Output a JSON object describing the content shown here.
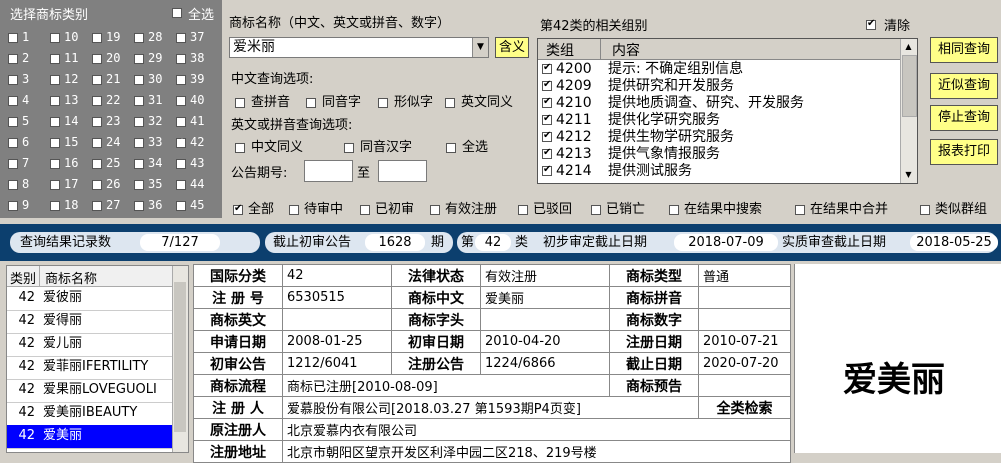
{
  "category_panel": {
    "title": "选择商标类别",
    "select_all_label": "全选",
    "select_all_checked": false,
    "categories": [
      {
        "n": "1",
        "c": false
      },
      {
        "n": "10",
        "c": false
      },
      {
        "n": "19",
        "c": false
      },
      {
        "n": "28",
        "c": false
      },
      {
        "n": "37",
        "c": false
      },
      {
        "n": "2",
        "c": false
      },
      {
        "n": "11",
        "c": false
      },
      {
        "n": "20",
        "c": false
      },
      {
        "n": "29",
        "c": false
      },
      {
        "n": "38",
        "c": false
      },
      {
        "n": "3",
        "c": false
      },
      {
        "n": "12",
        "c": false
      },
      {
        "n": "21",
        "c": false
      },
      {
        "n": "30",
        "c": false
      },
      {
        "n": "39",
        "c": false
      },
      {
        "n": "4",
        "c": false
      },
      {
        "n": "13",
        "c": false
      },
      {
        "n": "22",
        "c": false
      },
      {
        "n": "31",
        "c": false
      },
      {
        "n": "40",
        "c": false
      },
      {
        "n": "5",
        "c": false
      },
      {
        "n": "14",
        "c": false
      },
      {
        "n": "23",
        "c": false
      },
      {
        "n": "32",
        "c": false
      },
      {
        "n": "41",
        "c": false
      },
      {
        "n": "6",
        "c": false
      },
      {
        "n": "15",
        "c": false
      },
      {
        "n": "24",
        "c": false
      },
      {
        "n": "33",
        "c": false
      },
      {
        "n": "42",
        "c": true
      },
      {
        "n": "7",
        "c": false
      },
      {
        "n": "16",
        "c": false
      },
      {
        "n": "25",
        "c": false
      },
      {
        "n": "34",
        "c": false
      },
      {
        "n": "43",
        "c": false
      },
      {
        "n": "8",
        "c": false
      },
      {
        "n": "17",
        "c": false
      },
      {
        "n": "26",
        "c": false
      },
      {
        "n": "35",
        "c": false
      },
      {
        "n": "44",
        "c": false
      },
      {
        "n": "9",
        "c": false
      },
      {
        "n": "18",
        "c": false
      },
      {
        "n": "27",
        "c": false
      },
      {
        "n": "36",
        "c": false
      },
      {
        "n": "45",
        "c": false
      }
    ]
  },
  "search": {
    "name_label": "商标名称（中文、英文或拼音、数字）",
    "name_value": "爱米丽",
    "meaning_button": "含义",
    "chinese_options_label": "中文查询选项:",
    "chinese_options": [
      {
        "label": "查拼音",
        "checked": false
      },
      {
        "label": "同音字",
        "checked": false
      },
      {
        "label": "形似字",
        "checked": false
      },
      {
        "label": "英文同义",
        "checked": false
      }
    ],
    "english_options_label": "英文或拼音查询选项:",
    "english_options": [
      {
        "label": "中文同义",
        "checked": false
      },
      {
        "label": "同音汉字",
        "checked": false
      },
      {
        "label": "全选",
        "checked": false
      }
    ],
    "issue_label": "公告期号:",
    "issue_to": "至",
    "issue_from_value": "",
    "issue_to_value": ""
  },
  "groups": {
    "title": "第42类的相关组别",
    "clear_label": "清除",
    "clear_checked": true,
    "col_group": "类组",
    "col_content": "内容",
    "rows": [
      {
        "code": "4200",
        "text": "提示: 不确定组别信息",
        "checked": true
      },
      {
        "code": "4209",
        "text": "提供研究和开发服务",
        "checked": true
      },
      {
        "code": "4210",
        "text": "提供地质调查、研究、开发服务",
        "checked": true
      },
      {
        "code": "4211",
        "text": "提供化学研究服务",
        "checked": true
      },
      {
        "code": "4212",
        "text": "提供生物学研究服务",
        "checked": true
      },
      {
        "code": "4213",
        "text": "提供气象情报服务",
        "checked": true
      },
      {
        "code": "4214",
        "text": "提供测试服务",
        "checked": true
      }
    ]
  },
  "actions": {
    "same": "相同查询",
    "similar": "近似查询",
    "stop": "停止查询",
    "print": "报表打印"
  },
  "filters": [
    {
      "label": "全部",
      "checked": true
    },
    {
      "label": "待审中",
      "checked": false
    },
    {
      "label": "已初审",
      "checked": false
    },
    {
      "label": "有效注册",
      "checked": false
    },
    {
      "label": "已驳回",
      "checked": false
    },
    {
      "label": "已销亡",
      "checked": false
    },
    {
      "label": "在结果中搜索",
      "checked": false
    },
    {
      "label": "在结果中合并",
      "checked": false
    },
    {
      "label": "类似群组",
      "checked": false
    }
  ],
  "statusbar": {
    "record_label": "查询结果记录数",
    "record_value": "7/127",
    "cutoff_label": "截止初审公告",
    "cutoff_value": "1628",
    "cutoff_unit": "期",
    "class_prefix": "第",
    "class_value": "42",
    "class_suffix": "类",
    "prelim_label": "初步审定截止日期",
    "prelim_value": "2018-07-09",
    "substantive_label": "实质审查截止日期",
    "substantive_value": "2018-05-25"
  },
  "results": {
    "col_class": "类别",
    "col_name": "商标名称",
    "rows": [
      {
        "cls": "42",
        "name": "爱彼丽"
      },
      {
        "cls": "42",
        "name": "爱得丽"
      },
      {
        "cls": "42",
        "name": "爱儿丽"
      },
      {
        "cls": "42",
        "name": "爱菲丽IFERTILITY"
      },
      {
        "cls": "42",
        "name": "爱果丽LOVEGUOLI"
      },
      {
        "cls": "42",
        "name": "爱美丽IBEAUTY"
      },
      {
        "cls": "42",
        "name": "爱美丽"
      }
    ],
    "selected_index": 6
  },
  "detail": {
    "intl_class_k": "国际分类",
    "intl_class_v": "42",
    "legal_k": "法律状态",
    "legal_v": "有效注册",
    "type_k": "商标类型",
    "type_v": "普通",
    "regno_k": "注 册 号",
    "regno_v": "6530515",
    "cn_k": "商标中文",
    "cn_v": "爱美丽",
    "py_k": "商标拼音",
    "py_v": "",
    "en_k": "商标英文",
    "en_v": "",
    "head_k": "商标字头",
    "head_v": "",
    "num_k": "商标数字",
    "num_v": "",
    "apply_k": "申请日期",
    "apply_v": "2008-01-25",
    "prelim_k": "初审日期",
    "prelim_v": "2010-04-20",
    "regdate_k": "注册日期",
    "regdate_v": "2010-07-21",
    "prelimpub_k": "初审公告",
    "prelimpub_v": "1212/6041",
    "regpub_k": "注册公告",
    "regpub_v": "1224/6866",
    "expire_k": "截止日期",
    "expire_v": "2020-07-20",
    "flow_k": "商标流程",
    "flow_v": "商标已注册[2010-08-09]",
    "warn_k": "商标预告",
    "warn_v": "",
    "owner_k": "注 册 人",
    "owner_v": "爱慕股份有限公司[2018.03.27 第1593期P4页变]",
    "allclass": "全类检索",
    "origowner_k": "原注册人",
    "origowner_v": "北京爱慕内衣有限公司",
    "addr_k": "注册地址",
    "addr_v": "北京市朝阳区望京开发区利泽中园二区218、219号楼"
  },
  "preview_text": "爱美丽"
}
